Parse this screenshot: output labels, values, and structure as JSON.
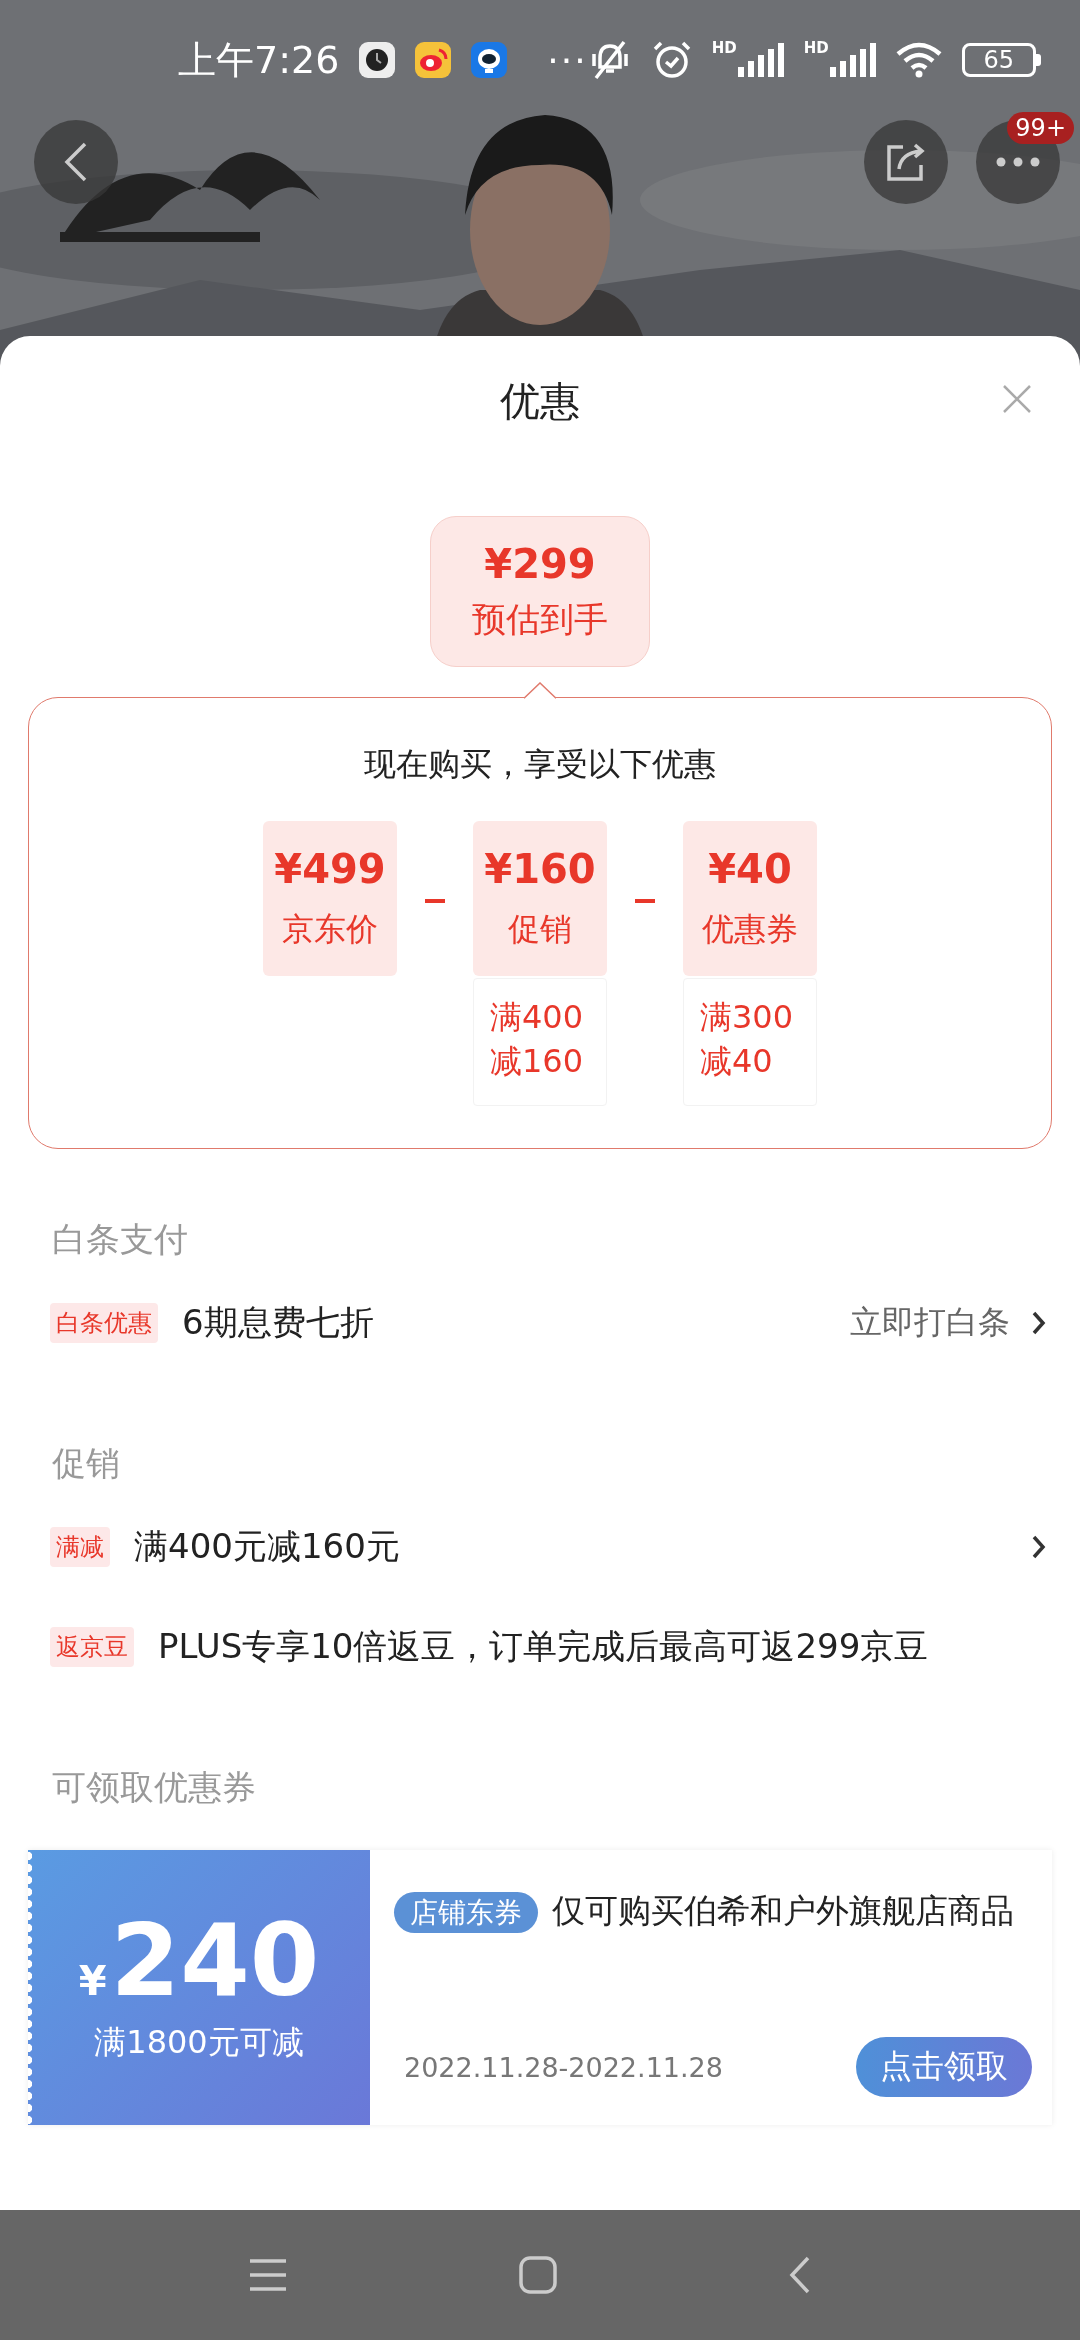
{
  "status_bar": {
    "time": "上午7:26",
    "more": "···",
    "signal_labels": [
      "HD",
      "HD"
    ],
    "battery": "65"
  },
  "header": {
    "badge": "99+"
  },
  "sheet": {
    "title": "优惠"
  },
  "estimate": {
    "price": "¥299",
    "label": "预估到手"
  },
  "breakdown": {
    "title": "现在购买，享受以下优惠",
    "items": [
      {
        "amount": "¥499",
        "label": "京东价"
      },
      {
        "amount": "¥160",
        "label": "促销",
        "detail": [
          "满400",
          "减160"
        ]
      },
      {
        "amount": "¥40",
        "label": "优惠券",
        "detail": [
          "满300",
          "减40"
        ]
      }
    ]
  },
  "sections": [
    {
      "title": "白条支付",
      "rows": [
        {
          "tag": "白条优惠",
          "text": "6期息费七折",
          "action": "立即打白条",
          "arrow": true
        }
      ]
    },
    {
      "title": "促销",
      "rows": [
        {
          "tag": "满减",
          "text": "满400元减160元",
          "arrow": true
        },
        {
          "tag": "返京豆",
          "text": "PLUS专享10倍返豆，订单完成后最高可返299京豆",
          "arrow": false
        }
      ]
    },
    {
      "title": "可领取优惠券"
    }
  ],
  "coupons": [
    {
      "symbol": "¥",
      "amount": "240",
      "condition": "满1800元可减",
      "tag": "店铺东券",
      "description": "仅可购买伯希和户外旗舰店商品",
      "validity": "2022.11.28-2022.11.28",
      "button": "点击领取"
    }
  ]
}
